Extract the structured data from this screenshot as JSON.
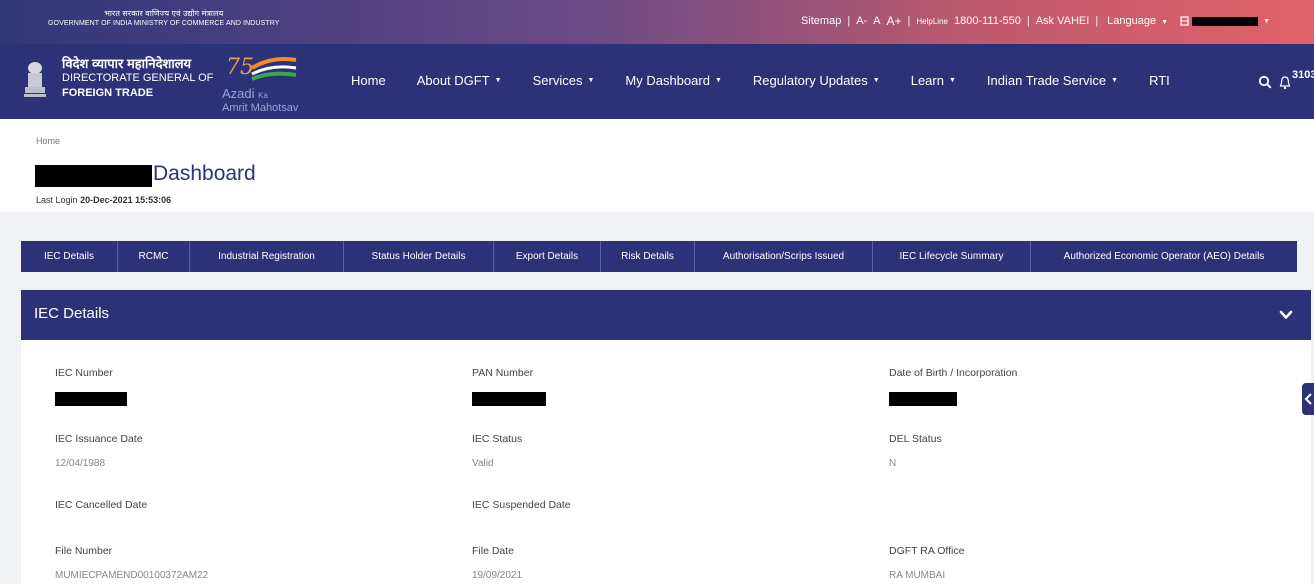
{
  "gov_header": {
    "hindi": "भारत सरकार  वाणिज्य एवं उद्योग मंत्रालय",
    "english": "GOVERNMENT OF INDIA   MINISTRY OF COMMERCE AND INDUSTRY"
  },
  "utility_bar": {
    "sitemap": "Sitemap",
    "font_small": "A-",
    "font_normal": "A",
    "font_large": "A+",
    "helpline_label": "HelpLine",
    "helpline_number": "1800-111-550",
    "ask": "Ask VAHEI",
    "language": "Language"
  },
  "brand": {
    "hindi": "विदेश व्यापार महानिदेशालय",
    "line1": "DIRECTORATE GENERAL OF",
    "line2": "FOREIGN TRADE",
    "azadi_1": "Azadi",
    "azadi_2": "Ka",
    "azadi_3": "Amrit Mahotsav"
  },
  "nav": {
    "items": [
      {
        "label": "Home",
        "dropdown": false
      },
      {
        "label": "About DGFT",
        "dropdown": true
      },
      {
        "label": "Services",
        "dropdown": true
      },
      {
        "label": "My Dashboard",
        "dropdown": true
      },
      {
        "label": "Regulatory Updates",
        "dropdown": true
      },
      {
        "label": "Learn",
        "dropdown": true
      },
      {
        "label": "Indian Trade Service",
        "dropdown": true
      },
      {
        "label": "RTI",
        "dropdown": false
      }
    ],
    "notification_count": "3103"
  },
  "page": {
    "breadcrumb": "Home",
    "title": "Dashboard",
    "last_login_label": "Last Login",
    "last_login_value": "20-Dec-2021 15:53:06"
  },
  "tabs": [
    "IEC Details",
    "RCMC",
    "Industrial Registration",
    "Status Holder Details",
    "Export Details",
    "Risk Details",
    "Authorisation/Scrips Issued",
    "IEC Lifecycle Summary",
    "Authorized Economic Operator (AEO) Details"
  ],
  "panel": {
    "title": "IEC Details",
    "fields": {
      "iec_number": {
        "label": "IEC Number"
      },
      "pan_number": {
        "label": "PAN Number"
      },
      "dob": {
        "label": "Date of Birth / Incorporation"
      },
      "issuance_date": {
        "label": "IEC Issuance Date",
        "value": "12/04/1988"
      },
      "iec_status": {
        "label": "IEC Status",
        "value": "Valid"
      },
      "del_status": {
        "label": "DEL Status",
        "value": "N"
      },
      "cancelled_date": {
        "label": "IEC Cancelled Date"
      },
      "suspended_date": {
        "label": "IEC Suspended Date"
      },
      "file_number": {
        "label": "File Number",
        "value": "MUMIECPAMEND00100372AM22"
      },
      "file_date": {
        "label": "File Date",
        "value": "19/09/2021"
      },
      "ra_office": {
        "label": "DGFT RA Office",
        "value": "RA MUMBAI"
      }
    }
  },
  "colors": {
    "primary": "#2b3278",
    "gradient_end": "#e0606a"
  }
}
